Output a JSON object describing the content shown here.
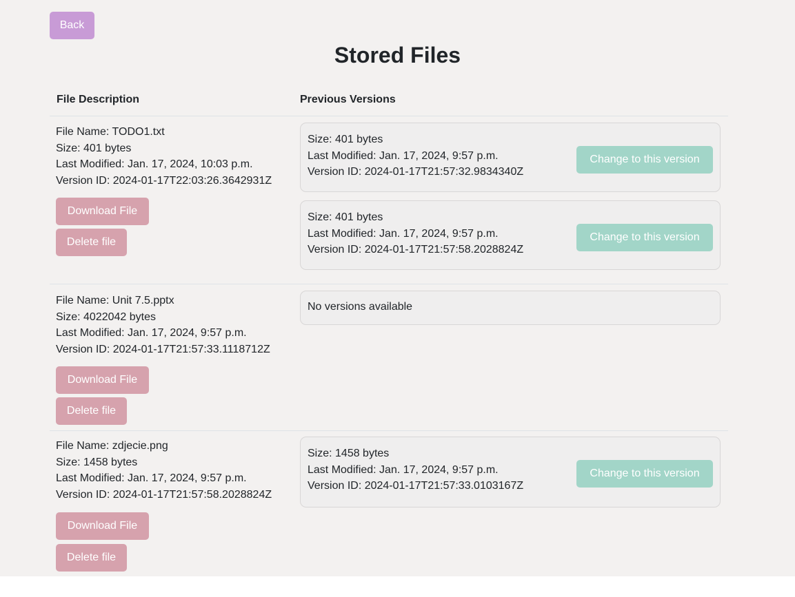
{
  "header": {
    "back_label": "Back",
    "title": "Stored Files"
  },
  "table": {
    "columns": [
      "File Description",
      "Previous Versions"
    ]
  },
  "files": [
    {
      "name": "File Name: TODO1.txt",
      "size": "Size: 401 bytes",
      "modified": "Last Modified: Jan. 17, 2024, 10:03 p.m.",
      "version_id": "Version ID: 2024-01-17T22:03:26.3642931Z",
      "download_label": "Download File",
      "delete_label": "Delete file",
      "versions": [
        {
          "size": "Size: 401 bytes",
          "modified": "Last Modified: Jan. 17, 2024, 9:57 p.m.",
          "version_id": "Version ID: 2024-01-17T21:57:32.9834340Z",
          "change_label": "Change to this version"
        },
        {
          "size": "Size: 401 bytes",
          "modified": "Last Modified: Jan. 17, 2024, 9:57 p.m.",
          "version_id": "Version ID: 2024-01-17T21:57:58.2028824Z",
          "change_label": "Change to this version"
        }
      ]
    },
    {
      "name": "File Name: Unit 7.5.pptx",
      "size": "Size: 4022042 bytes",
      "modified": "Last Modified: Jan. 17, 2024, 9:57 p.m.",
      "version_id": "Version ID: 2024-01-17T21:57:33.1118712Z",
      "download_label": "Download File",
      "delete_label": "Delete file",
      "no_versions_text": "No versions available"
    },
    {
      "name": "File Name: zdjecie.png",
      "size": "Size: 1458 bytes",
      "modified": "Last Modified: Jan. 17, 2024, 9:57 p.m.",
      "version_id": "Version ID: 2024-01-17T21:57:58.2028824Z",
      "download_label": "Download File",
      "delete_label": "Delete file",
      "versions": [
        {
          "size": "Size: 1458 bytes",
          "modified": "Last Modified: Jan. 17, 2024, 9:57 p.m.",
          "version_id": "Version ID: 2024-01-17T21:57:33.0103167Z",
          "change_label": "Change to this version"
        }
      ]
    }
  ],
  "colors": {
    "page_background": "#f3f1f0",
    "back_button": "#c89bd6",
    "download_delete_button": "#d6a2ad",
    "change_version_button": "#a2d5c8",
    "version_card": "#efeeee"
  }
}
